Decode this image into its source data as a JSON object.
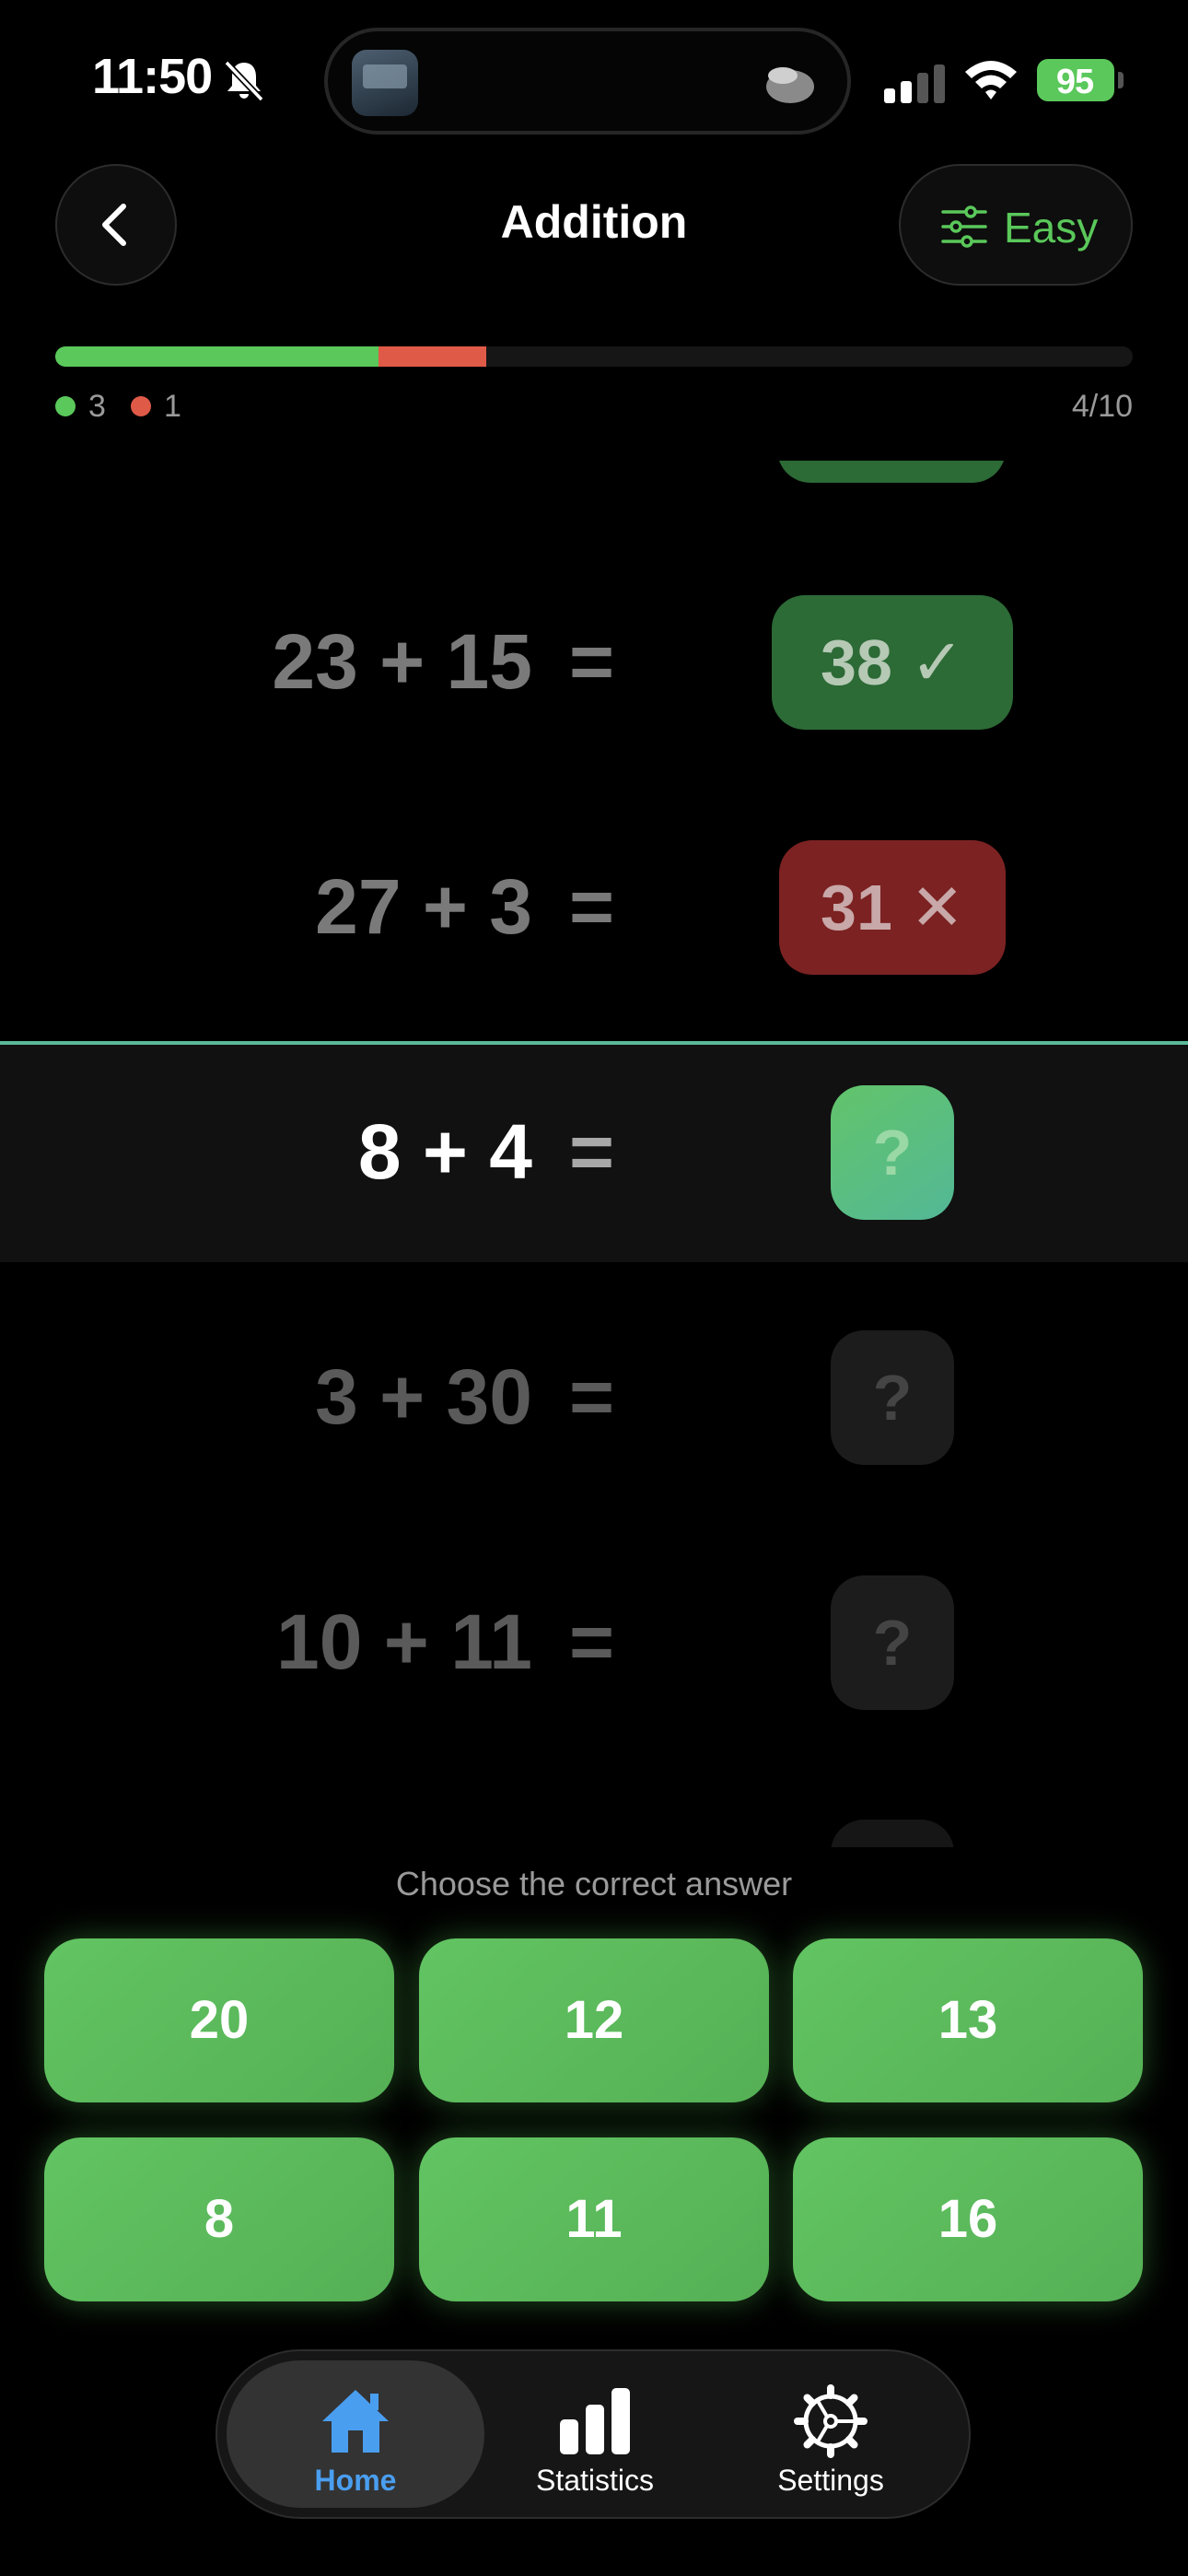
{
  "status_bar": {
    "time": "11:50",
    "battery": "95"
  },
  "header": {
    "title": "Addition",
    "difficulty": "Easy"
  },
  "progress": {
    "correct": 3,
    "wrong": 1,
    "answered": 4,
    "total": 10,
    "correct_label": "3",
    "wrong_label": "1",
    "count_label": "4/10"
  },
  "questions": [
    {
      "expression": "23 + 15",
      "equals": "=",
      "answer": "38 ✓",
      "state": "correct"
    },
    {
      "expression": "27 + 3",
      "equals": "=",
      "answer": "31 ✕",
      "state": "wrong"
    },
    {
      "expression": "8 + 4",
      "equals": "=",
      "answer": "?",
      "state": "current"
    },
    {
      "expression": "3 + 30",
      "equals": "=",
      "answer": "?",
      "state": "pending"
    },
    {
      "expression": "10 + 11",
      "equals": "=",
      "answer": "?",
      "state": "pending"
    }
  ],
  "prompt": "Choose the correct answer",
  "choices": [
    "20",
    "12",
    "13",
    "8",
    "11",
    "16"
  ],
  "tabs": [
    {
      "label": "Home",
      "icon": "house-icon",
      "active": true
    },
    {
      "label": "Statistics",
      "icon": "bar-chart-icon",
      "active": false
    },
    {
      "label": "Settings",
      "icon": "gear-icon",
      "active": false
    }
  ],
  "colors": {
    "accent": "#5ac85a",
    "wrong": "#e05a48",
    "tab_active": "#4a9ef0"
  }
}
